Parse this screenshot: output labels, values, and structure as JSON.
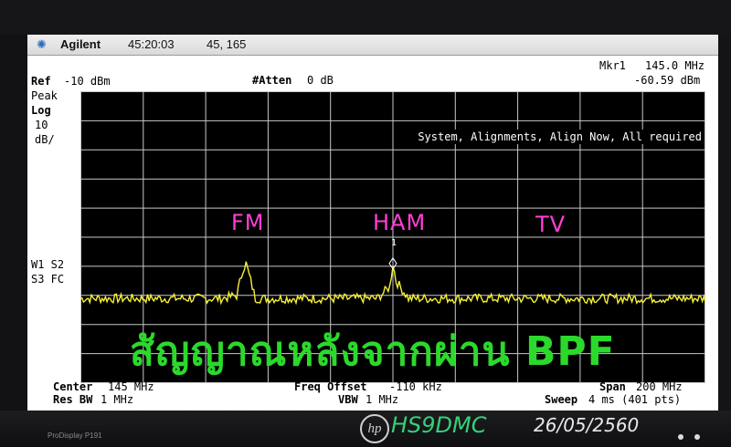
{
  "titlebar": {
    "logo_icon": "agilent-spark-icon",
    "brand": "Agilent",
    "time": "45:20:03",
    "coords": "45, 165"
  },
  "header": {
    "ref": "Ref",
    "ref_value": "-10 dBm",
    "atten": "#Atten",
    "atten_value": "0 dB",
    "marker_label": "Mkr1",
    "marker_freq": "145.0 MHz",
    "marker_level": "-60.59 dBm"
  },
  "left_panel": {
    "peak": "Peak",
    "log": "Log",
    "scale_value": "10",
    "scale_unit": "dB/",
    "w1s2": "W1 S2",
    "s3fc": "S3 FC"
  },
  "message": "System, Alignments, Align Now, All required",
  "annotations": {
    "fm": "FM",
    "ham": "HAM",
    "tv": "TV",
    "caption": "สัญญาณหลังจากผ่าน BPF",
    "marker_num": "1"
  },
  "footer": {
    "center_label": "Center",
    "center_value": "145 MHz",
    "res_bw_label": "Res BW",
    "res_bw_value": "1 MHz",
    "freq_offset_label": "Freq Offset",
    "freq_offset_value": "-110 kHz",
    "vbw_label": "VBW",
    "vbw_value": "1 MHz",
    "span_label": "Span",
    "span_value": "200 MHz",
    "sweep_label": "Sweep",
    "sweep_value": "4 ms (401 pts)"
  },
  "monitor": {
    "model": "ProDisplay P191",
    "logo": "hp",
    "callsign": "HS9DMC",
    "date": "26/05/2560"
  },
  "colors": {
    "trace": "#f5f03a",
    "grid": "#c8c8c8",
    "annotation": "#ff3fd8",
    "caption": "#2bd92b"
  },
  "chart_data": {
    "type": "line",
    "x_unit": "MHz",
    "y_unit": "dBm",
    "xlim": [
      45,
      245
    ],
    "ylim": [
      -110,
      -10
    ],
    "grid": true,
    "series": [
      {
        "x": [
          45,
          70,
          90,
          95,
          97,
          98,
          99,
          101,
          110,
          125,
          140,
          144,
          145,
          146,
          150,
          165,
          190,
          215,
          245
        ],
        "y": [
          -81,
          -81,
          -81,
          -80,
          -71,
          -69,
          -73,
          -81,
          -81,
          -81,
          -81,
          -77,
          -69,
          -75,
          -81,
          -81,
          -81,
          -81,
          -81
        ]
      }
    ]
  }
}
